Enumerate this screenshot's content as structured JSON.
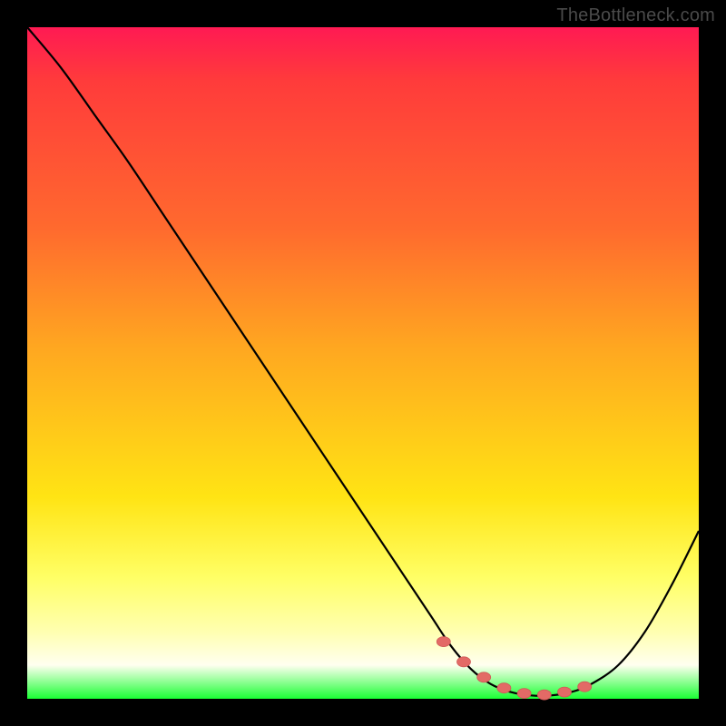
{
  "watermark": {
    "text": "TheBottleneck.com"
  },
  "colors": {
    "background": "#000000",
    "curve_stroke": "#000000",
    "marker_fill": "#e36a66",
    "marker_stroke": "#cf5a56"
  },
  "chart_data": {
    "type": "line",
    "title": "",
    "xlabel": "",
    "ylabel": "",
    "xlim": [
      0,
      100
    ],
    "ylim": [
      0,
      100
    ],
    "series": [
      {
        "name": "bottleneck-curve",
        "x": [
          0,
          5,
          10,
          15,
          20,
          25,
          30,
          35,
          40,
          45,
          50,
          55,
          60,
          63,
          66,
          69,
          72,
          75,
          78,
          81,
          84,
          88,
          92,
          96,
          100
        ],
        "values": [
          100,
          94,
          87,
          80,
          72.5,
          65,
          57.5,
          50,
          42.5,
          35,
          27.5,
          20,
          12.5,
          8,
          4.5,
          2.2,
          1,
          0.5,
          0.5,
          1,
          2.2,
          5,
          10,
          17,
          25
        ]
      }
    ],
    "markers": {
      "name": "highlighted-range",
      "x": [
        62,
        65,
        68,
        71,
        74,
        77,
        80,
        83
      ],
      "values": [
        8.5,
        5.5,
        3.2,
        1.6,
        0.8,
        0.6,
        1.0,
        1.8
      ]
    }
  }
}
